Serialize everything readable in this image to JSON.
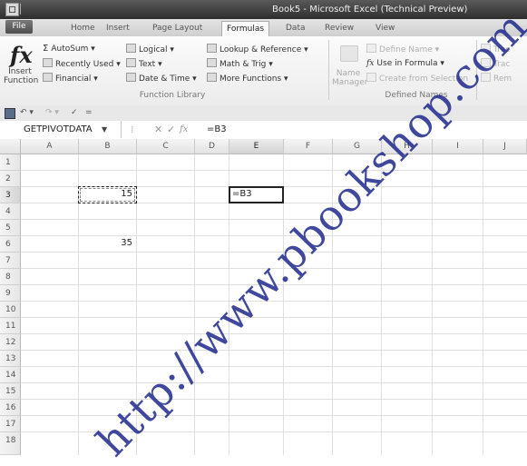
{
  "window": {
    "title": "Book5 - Microsoft Excel (Technical Preview)"
  },
  "ribbon_tabs": {
    "file": "File",
    "tabs": [
      "Home",
      "Insert",
      "Page Layout",
      "Formulas",
      "Data",
      "Review",
      "View"
    ],
    "active": "Formulas"
  },
  "ribbon": {
    "insert_function": {
      "line1": "Insert",
      "line2": "Function"
    },
    "autosum": "AutoSum",
    "recently_used": "Recently Used",
    "financial": "Financial",
    "logical": "Logical",
    "text": "Text",
    "date_time": "Date & Time",
    "lookup_reference": "Lookup & Reference",
    "math_trig": "Math & Trig",
    "more_functions": "More Functions",
    "function_library_label": "Function Library",
    "name_manager": {
      "line1": "Name",
      "line2": "Manager"
    },
    "define_name": "Define Name",
    "use_in_formula": "Use in Formula",
    "create_from_selection": "Create from Selection",
    "defined_names_label": "Defined Names",
    "trace_precedents": "Trac",
    "trace_dependents": "Trac",
    "remove_arrows": "Rem"
  },
  "formula_bar": {
    "name_box": "GETPIVOTDATA",
    "cancel_symbol": "✕",
    "enter_symbol": "✓",
    "fx_symbol": "fx",
    "formula": "=B3"
  },
  "sheet": {
    "columns": [
      "A",
      "B",
      "C",
      "D",
      "E",
      "F",
      "G",
      "H",
      "I",
      "J"
    ],
    "selected_column": "E",
    "rows": [
      "1",
      "2",
      "3",
      "4",
      "5",
      "6",
      "7",
      "8",
      "9",
      "10",
      "11",
      "12",
      "13",
      "14",
      "15",
      "16",
      "17",
      "18"
    ],
    "selected_row": "3",
    "cells": {
      "B3": "15",
      "B6": "35",
      "E3": "=B3"
    },
    "active_cell": "E3",
    "copy_range": "B3"
  },
  "watermark": "http://www.pbookshop.com"
}
